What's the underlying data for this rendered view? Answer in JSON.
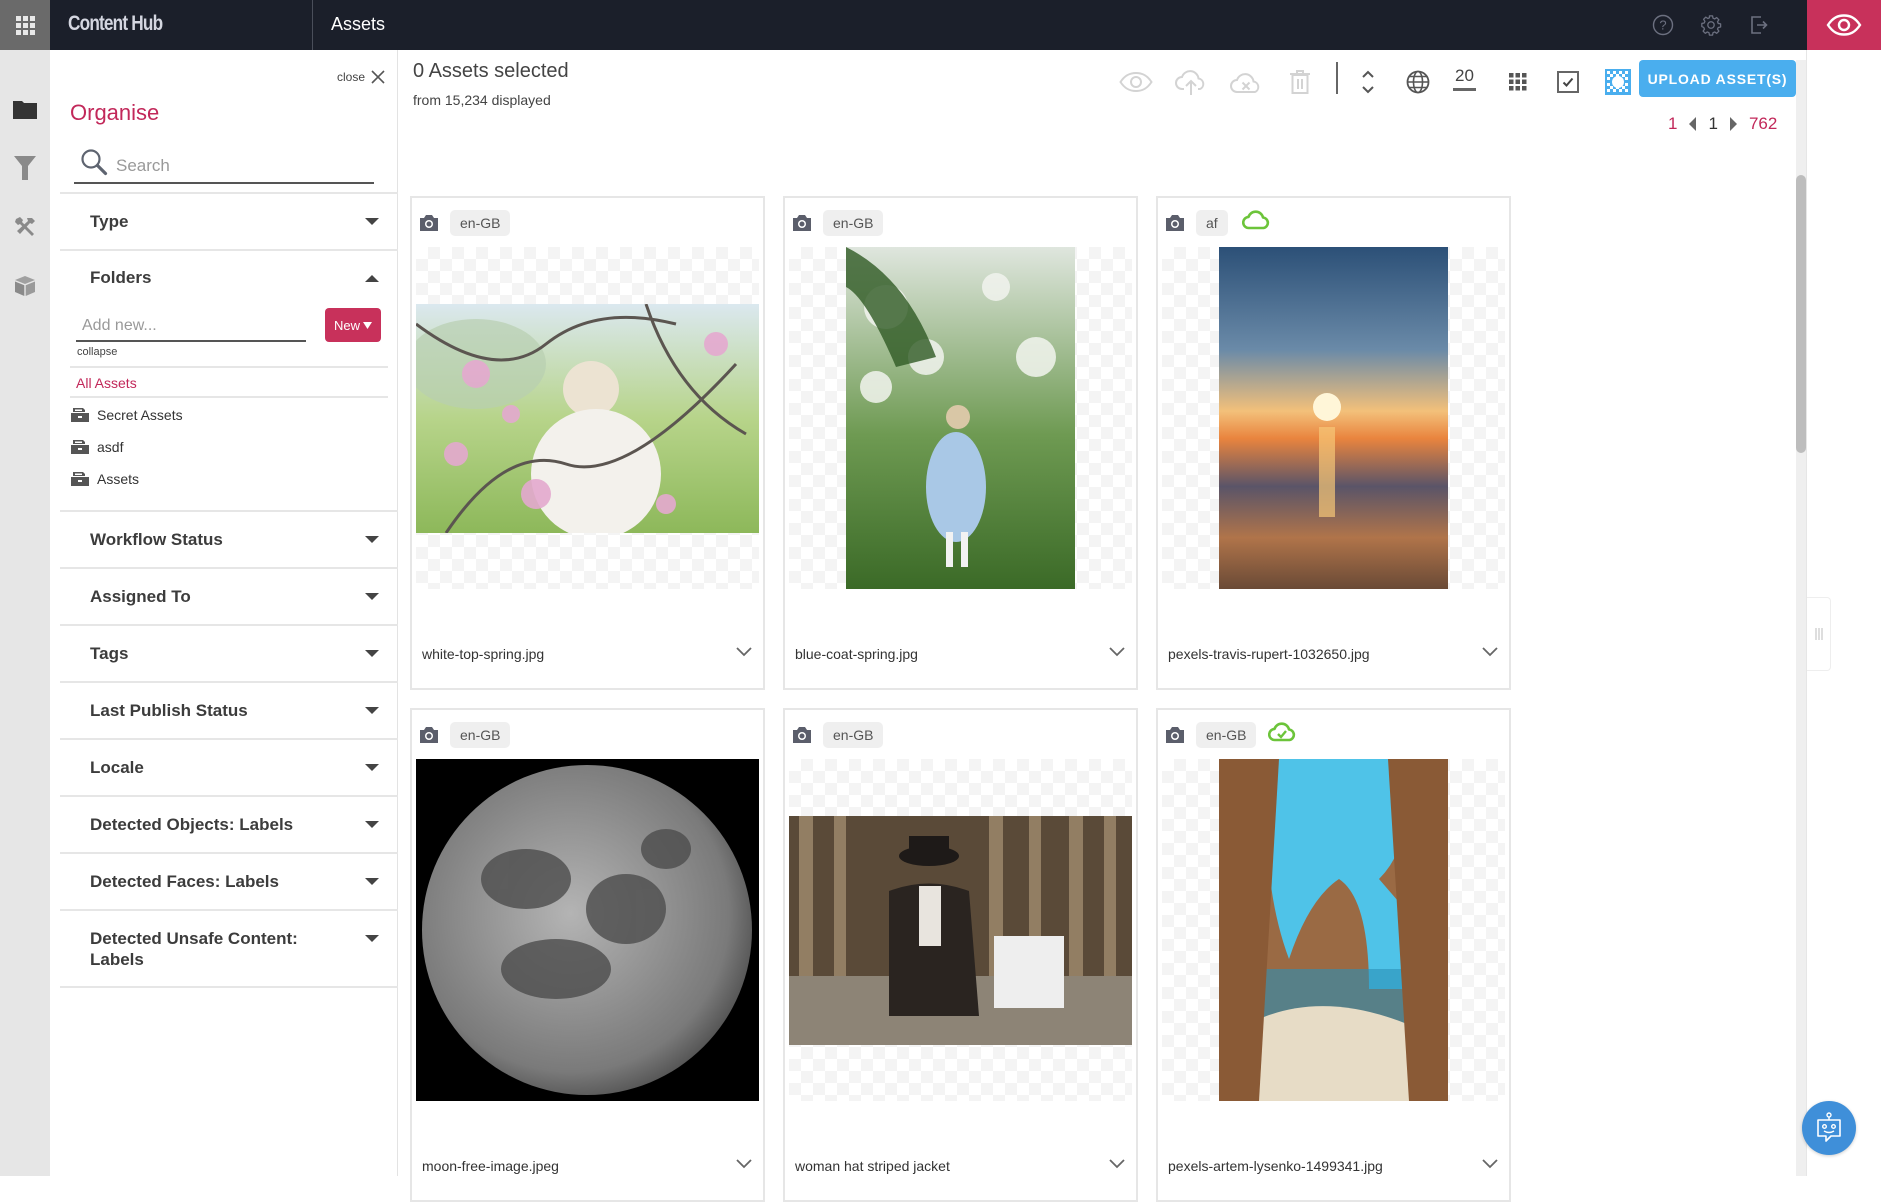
{
  "topbar": {
    "brand": "Content Hub",
    "page_title": "Assets",
    "icons": [
      "apps-grid-icon",
      "help-icon",
      "settings-gear-icon",
      "logout-icon",
      "preview-eye-icon"
    ]
  },
  "rail": {
    "items": [
      {
        "name": "folders",
        "icon": "folder-icon"
      },
      {
        "name": "filters",
        "icon": "filter-funnel-icon"
      },
      {
        "name": "tools",
        "icon": "tools-icon"
      },
      {
        "name": "packages",
        "icon": "box-icon"
      }
    ]
  },
  "panel": {
    "close_label": "close",
    "title": "Organise",
    "search_placeholder": "Search",
    "sections_top": [
      {
        "label": "Type",
        "expanded": false
      }
    ],
    "folders": {
      "label": "Folders",
      "expanded": true,
      "add_placeholder": "Add new...",
      "new_button": "New",
      "collapse_label": "collapse",
      "all_assets": "All Assets",
      "items": [
        "Secret Assets",
        "asdf",
        "Assets"
      ]
    },
    "sections": [
      {
        "label": "Workflow Status"
      },
      {
        "label": "Assigned To"
      },
      {
        "label": "Tags"
      },
      {
        "label": "Last Publish Status"
      },
      {
        "label": "Locale"
      },
      {
        "label": "Detected Objects: Labels"
      },
      {
        "label": "Detected Faces: Labels"
      },
      {
        "label": "Detected Unsafe Content: Labels"
      }
    ]
  },
  "main": {
    "selected_title": "0 Assets selected",
    "selected_sub": "from 15,234 displayed",
    "toolbar": {
      "icons": [
        "view-eye-icon",
        "cloud-upload-icon",
        "cloud-remove-icon",
        "trash-icon",
        "sort-icon",
        "globe-icon",
        "grid-view-icon",
        "select-checkbox-icon",
        "transparency-toggle-icon"
      ],
      "per_page": "20",
      "upload_label": "UPLOAD ASSET(S)"
    },
    "pagination": {
      "first": "1",
      "current": "1",
      "last": "762"
    },
    "assets": [
      {
        "filename": "white-top-spring.jpg",
        "locale": "en-GB",
        "cloud": "none",
        "orientation": "landscape",
        "palette": [
          "#cfe0c8",
          "#a9c97a",
          "#e6c2d8",
          "#f2efe9"
        ]
      },
      {
        "filename": "blue-coat-spring.jpg",
        "locale": "en-GB",
        "cloud": "none",
        "orientation": "portrait",
        "palette": [
          "#dfe8e0",
          "#4b7a3a",
          "#a8c6e8",
          "#2f5a24"
        ]
      },
      {
        "filename": "pexels-travis-rupert-1032650.jpg",
        "locale": "af",
        "cloud": "outline",
        "orientation": "portrait",
        "palette": [
          "#2e5376",
          "#f4b760",
          "#e37a3b",
          "#6a4a36"
        ]
      },
      {
        "filename": "moon-free-image.jpeg",
        "locale": "en-GB",
        "cloud": "none",
        "orientation": "square",
        "palette": [
          "#000000",
          "#9a9a9a",
          "#6d6d6d",
          "#3a3a3a"
        ]
      },
      {
        "filename": "woman hat striped jacket",
        "locale": "en-GB",
        "cloud": "none",
        "orientation": "landscape",
        "palette": [
          "#5a4a38",
          "#a08b6e",
          "#2a2420",
          "#eeeeee"
        ]
      },
      {
        "filename": "pexels-artem-lysenko-1499341.jpg",
        "locale": "en-GB",
        "cloud": "check",
        "orientation": "portrait",
        "palette": [
          "#4fc3e8",
          "#9a6a44",
          "#2c8fb5",
          "#e7dcc6"
        ]
      }
    ]
  },
  "colors": {
    "accent_pink": "#c2285a",
    "upload_blue": "#4aaeee",
    "cloud_green": "#6cc43a",
    "topbar_bg": "#1b1f2a"
  }
}
